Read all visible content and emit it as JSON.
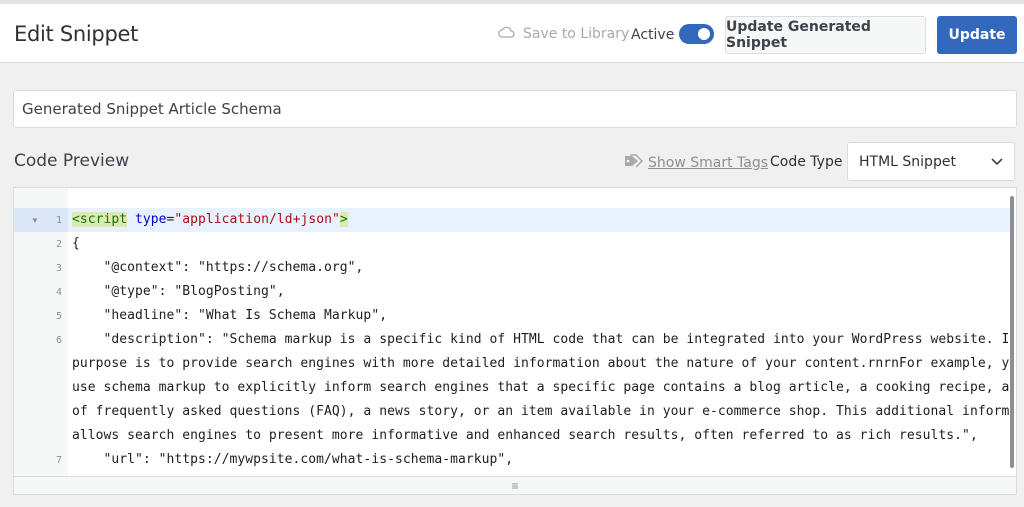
{
  "header": {
    "title": "Edit Snippet",
    "save_to_library": "Save to Library",
    "active_label": "Active",
    "update_generated_button": "Update Generated Snippet",
    "update_button": "Update"
  },
  "snippet": {
    "title_value": "Generated Snippet Article Schema"
  },
  "code_preview": {
    "label": "Code Preview",
    "show_smart_tags": "Show Smart Tags",
    "code_type_label": "Code Type",
    "code_type_selected": "HTML Snippet"
  },
  "editor": {
    "line_numbers": [
      "1",
      "2",
      "3",
      "4",
      "5",
      "6",
      "7"
    ],
    "lines": {
      "l1_open": "<script",
      "l1_attr": " type",
      "l1_eq": "=",
      "l1_str": "\"application/ld+json\"",
      "l1_close": ">",
      "l2": "{",
      "l3": "    \"@context\": \"https://schema.org\",",
      "l4": "    \"@type\": \"BlogPosting\",",
      "l5": "    \"headline\": \"What Is Schema Markup\",",
      "l6a": "    \"description\": \"Schema markup is a specific kind of HTML code that can be integrated into your WordPress website. Its",
      "l6b": "purpose is to provide search engines with more detailed information about the nature of your content.rnrnFor example, you can",
      "l6c": "use schema markup to explicitly inform search engines that a specific page contains a blog article, a cooking recipe, a list",
      "l6d": "of frequently asked questions (FAQ), a news story, or an item available in your e-commerce shop. This additional information",
      "l6e": "allows search engines to present more informative and enhanced search results, often referred to as rich results.\",",
      "l7": "    \"url\": \"https://mywpsite.com/what-is-schema-markup\","
    }
  }
}
